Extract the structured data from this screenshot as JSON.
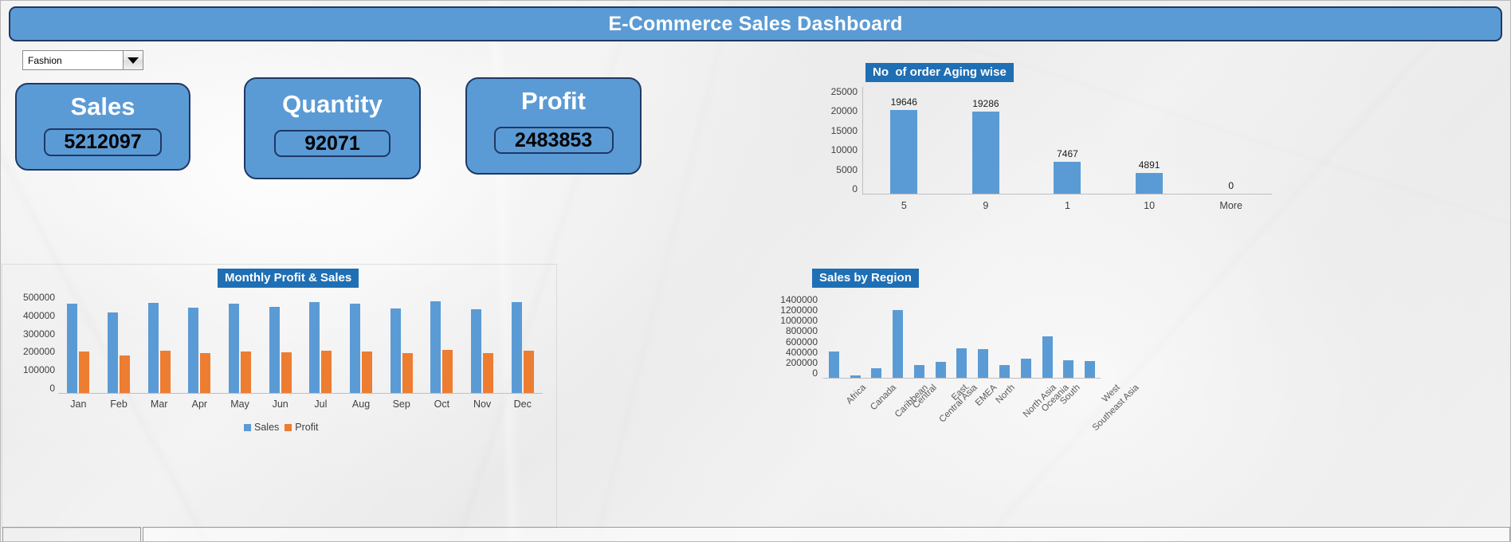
{
  "window": {
    "title": "E-Commerce Sales Dashboard"
  },
  "header": {
    "title": "E-Commerce Sales Dashboard",
    "accent_color": "#5b9bd5",
    "border_color": "#1f3864"
  },
  "filter": {
    "name": "category-filter",
    "selected": "Fashion",
    "icon": "chevron-down-icon"
  },
  "kpis": [
    {
      "label": "Sales",
      "value": "5212097"
    },
    {
      "label": "Quantity",
      "value": "92071"
    },
    {
      "label": "Profit",
      "value": "2483853"
    }
  ],
  "sheet_tabs": [
    {
      "label": ""
    },
    {
      "label": ""
    }
  ],
  "chart_data": [
    {
      "id": "order-aging",
      "type": "bar",
      "title": "No  of order Aging wise",
      "categories": [
        "5",
        "9",
        "1",
        "10",
        "More"
      ],
      "values": [
        19646,
        19286,
        7467,
        4891,
        0
      ],
      "data_labels": [
        "19646",
        "19286",
        "7467",
        "4891",
        "0"
      ],
      "yticks": [
        0,
        5000,
        10000,
        15000,
        20000,
        25000
      ],
      "ytick_labels": [
        "0",
        "5000",
        "10000",
        "15000",
        "20000",
        "25000"
      ],
      "ylim": [
        0,
        25000
      ],
      "xlabel": "",
      "ylabel": "",
      "grid": false,
      "legend": null,
      "series_color": "#5b9bd5"
    },
    {
      "id": "monthly-profit-sales",
      "type": "bar",
      "title": "Monthly Profit & Sales",
      "categories": [
        "Jan",
        "Feb",
        "Mar",
        "Apr",
        "May",
        "Jun",
        "Jul",
        "Aug",
        "Sep",
        "Oct",
        "Nov",
        "Dec"
      ],
      "series": [
        {
          "name": "Sales",
          "color": "#5b9bd5",
          "values": [
            443000,
            400000,
            450000,
            423000,
            443000,
            428000,
            452000,
            446000,
            420000,
            455000,
            418000,
            452000
          ]
        },
        {
          "name": "Profit",
          "color": "#ed7d31",
          "values": [
            206000,
            188000,
            210000,
            199000,
            206000,
            202000,
            210000,
            205000,
            198000,
            213000,
            197000,
            209000
          ]
        }
      ],
      "yticks": [
        0,
        100000,
        200000,
        300000,
        400000,
        500000
      ],
      "ytick_labels": [
        "0",
        "100000",
        "200000",
        "300000",
        "400000",
        "500000"
      ],
      "ylim": [
        0,
        500000
      ],
      "xlabel": "",
      "ylabel": "",
      "grid": false,
      "legend": {
        "position": "bottom",
        "entries": [
          "Sales",
          "Profit"
        ]
      }
    },
    {
      "id": "sales-by-region",
      "type": "bar",
      "title": "Sales by Region",
      "categories": [
        "Africa",
        "Canada",
        "Caribbean",
        "Central",
        "Central Asia",
        "East",
        "EMEA",
        "North",
        "North Asia",
        "Oceania",
        "South",
        "Southeast Asia",
        "West"
      ],
      "values": [
        440000,
        42000,
        160000,
        1140000,
        215000,
        275000,
        500000,
        485000,
        215000,
        320000,
        700000,
        290000,
        280000
      ],
      "yticks": [
        0,
        200000,
        400000,
        600000,
        800000,
        1000000,
        1200000,
        1400000
      ],
      "ytick_labels": [
        "0",
        "200000",
        "400000",
        "600000",
        "800000",
        "1000000",
        "1200000",
        "1400000"
      ],
      "ylim": [
        0,
        1400000
      ],
      "xlabel": "",
      "ylabel": "",
      "grid": false,
      "legend": null,
      "series_color": "#5b9bd5"
    }
  ]
}
